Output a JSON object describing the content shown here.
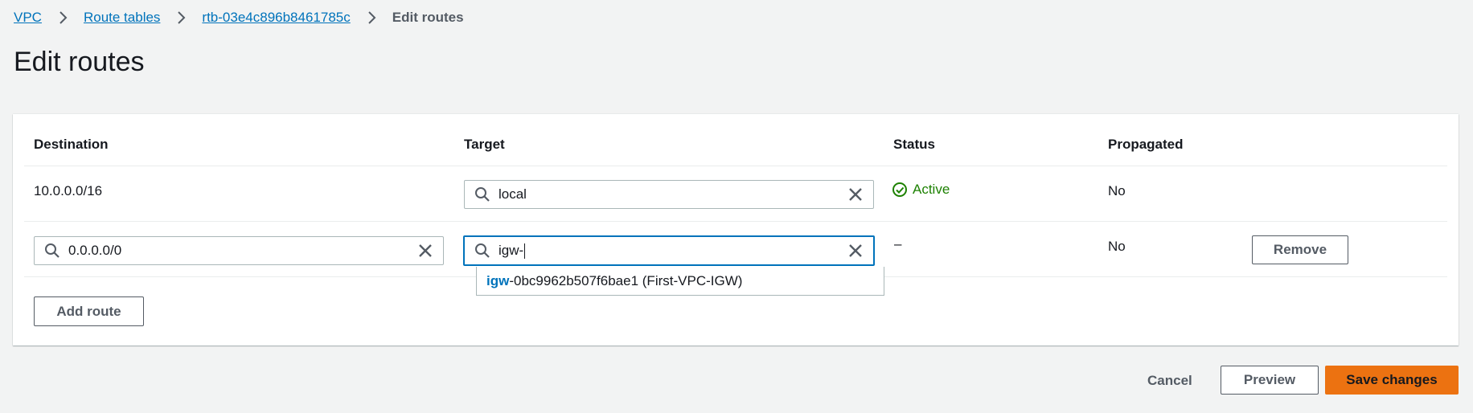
{
  "breadcrumb": {
    "items": [
      "VPC",
      "Route tables",
      "rtb-03e4c896b8461785c"
    ],
    "current": "Edit routes"
  },
  "page_title": "Edit routes",
  "table": {
    "headers": {
      "destination": "Destination",
      "target": "Target",
      "status": "Status",
      "propagated": "Propagated"
    },
    "rows": [
      {
        "destination": "10.0.0.0/16",
        "target_value": "local",
        "status": "Active",
        "propagated": "No"
      },
      {
        "destination_value": "0.0.0.0/0",
        "target_value": "igw-",
        "status": "–",
        "propagated": "No",
        "remove_label": "Remove"
      }
    ],
    "target_suggestion": {
      "match": "igw",
      "rest": "-0bc9962b507f6bae1 (First-VPC-IGW)"
    }
  },
  "add_route_label": "Add route",
  "footer": {
    "cancel_label": "Cancel",
    "preview_label": "Preview",
    "save_label": "Save changes"
  },
  "colors": {
    "link": "#0073bb",
    "active_status": "#1d8102",
    "primary_button": "#ec7211",
    "background": "#f2f3f3"
  },
  "icons": [
    "chevron-right-icon",
    "search-icon",
    "close-icon",
    "check-circle-icon"
  ]
}
